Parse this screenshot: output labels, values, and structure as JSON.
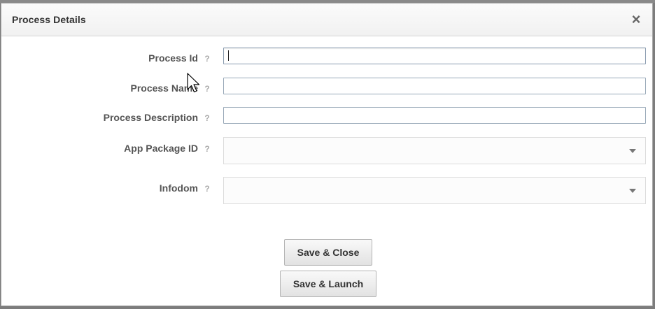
{
  "dialog": {
    "title": "Process Details",
    "close_symbol": "×"
  },
  "form": {
    "fields": [
      {
        "label": "Process Id",
        "help": "?",
        "type": "text",
        "value": ""
      },
      {
        "label": "Process Name",
        "help": "?",
        "type": "text",
        "value": ""
      },
      {
        "label": "Process Description",
        "help": "?",
        "type": "text",
        "value": ""
      },
      {
        "label": "App Package ID",
        "help": "?",
        "type": "select",
        "value": ""
      },
      {
        "label": "Infodom",
        "help": "?",
        "type": "select",
        "value": ""
      }
    ]
  },
  "buttons": {
    "save_close": "Save & Close",
    "save_launch": "Save & Launch"
  },
  "icons": {
    "close": "close-icon",
    "help": "question-mark-icon",
    "dropdown": "chevron-down-icon",
    "cursor": "mouse-pointer-icon"
  },
  "colors": {
    "input_border": "#98a8b8",
    "label_text": "#555555",
    "help_icon": "#aaaaaa"
  }
}
